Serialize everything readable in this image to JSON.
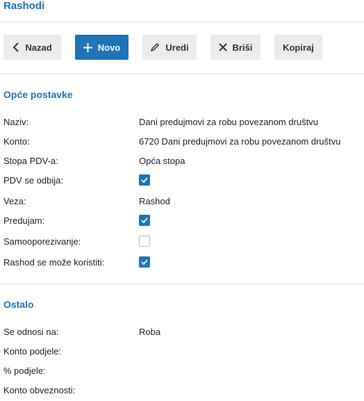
{
  "header": {
    "title": "Rashodi"
  },
  "toolbar": {
    "back": "Nazad",
    "new": "Novo",
    "edit": "Uredi",
    "delete": "Briši",
    "copy": "Kopiraj"
  },
  "general": {
    "title": "Opće postavke",
    "naziv_label": "Naziv:",
    "naziv_value": "Dani predujmovi za robu povezanom društvu",
    "konto_label": "Konto:",
    "konto_value": "6720 Dani predujmovi za robu povezanom društvu",
    "pdv_rate_label": "Stopa PDV-a:",
    "pdv_rate_value": "Opća stopa",
    "pdv_deductible_label": "PDV se odbija:",
    "pdv_deductible_checked": true,
    "veza_label": "Veza:",
    "veza_value": "Rashod",
    "predujam_label": "Predujam:",
    "predujam_checked": true,
    "self_tax_label": "Samooporezivanje:",
    "self_tax_checked": false,
    "usable_label": "Rashod se može koristiti:",
    "usable_checked": true
  },
  "other": {
    "title": "Ostalo",
    "relates_label": "Se odnosi na:",
    "relates_value": "Roba",
    "split_account_label": "Konto podjele:",
    "split_percent_label": "% podjele:",
    "liability_account_label": "Konto obveznosti:"
  },
  "colors": {
    "accent": "#1f73b7",
    "button_bg": "#ececec"
  }
}
